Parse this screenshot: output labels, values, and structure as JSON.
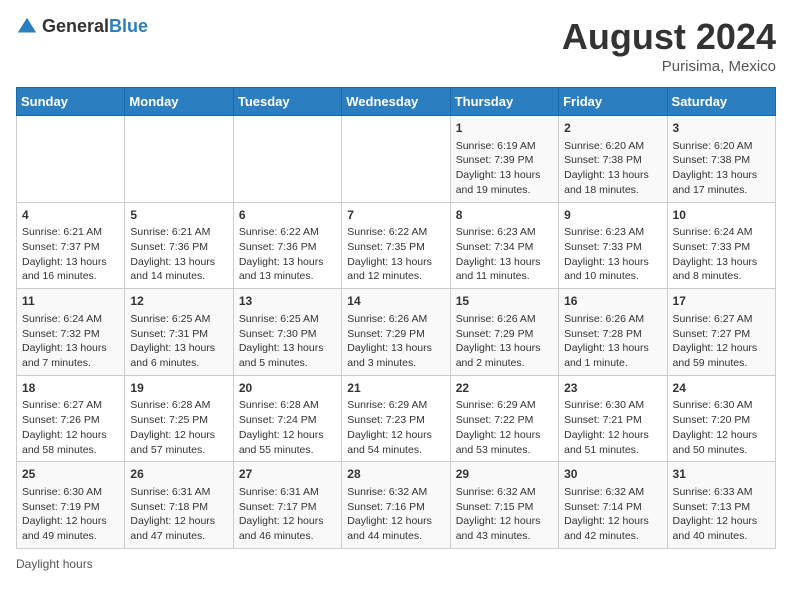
{
  "header": {
    "logo_general": "General",
    "logo_blue": "Blue",
    "title": "August 2024",
    "subtitle": "Purisima, Mexico"
  },
  "days_of_week": [
    "Sunday",
    "Monday",
    "Tuesday",
    "Wednesday",
    "Thursday",
    "Friday",
    "Saturday"
  ],
  "weeks": [
    [
      {
        "day": "",
        "info": ""
      },
      {
        "day": "",
        "info": ""
      },
      {
        "day": "",
        "info": ""
      },
      {
        "day": "",
        "info": ""
      },
      {
        "day": "1",
        "info": "Sunrise: 6:19 AM\nSunset: 7:39 PM\nDaylight: 13 hours and 19 minutes."
      },
      {
        "day": "2",
        "info": "Sunrise: 6:20 AM\nSunset: 7:38 PM\nDaylight: 13 hours and 18 minutes."
      },
      {
        "day": "3",
        "info": "Sunrise: 6:20 AM\nSunset: 7:38 PM\nDaylight: 13 hours and 17 minutes."
      }
    ],
    [
      {
        "day": "4",
        "info": "Sunrise: 6:21 AM\nSunset: 7:37 PM\nDaylight: 13 hours and 16 minutes."
      },
      {
        "day": "5",
        "info": "Sunrise: 6:21 AM\nSunset: 7:36 PM\nDaylight: 13 hours and 14 minutes."
      },
      {
        "day": "6",
        "info": "Sunrise: 6:22 AM\nSunset: 7:36 PM\nDaylight: 13 hours and 13 minutes."
      },
      {
        "day": "7",
        "info": "Sunrise: 6:22 AM\nSunset: 7:35 PM\nDaylight: 13 hours and 12 minutes."
      },
      {
        "day": "8",
        "info": "Sunrise: 6:23 AM\nSunset: 7:34 PM\nDaylight: 13 hours and 11 minutes."
      },
      {
        "day": "9",
        "info": "Sunrise: 6:23 AM\nSunset: 7:33 PM\nDaylight: 13 hours and 10 minutes."
      },
      {
        "day": "10",
        "info": "Sunrise: 6:24 AM\nSunset: 7:33 PM\nDaylight: 13 hours and 8 minutes."
      }
    ],
    [
      {
        "day": "11",
        "info": "Sunrise: 6:24 AM\nSunset: 7:32 PM\nDaylight: 13 hours and 7 minutes."
      },
      {
        "day": "12",
        "info": "Sunrise: 6:25 AM\nSunset: 7:31 PM\nDaylight: 13 hours and 6 minutes."
      },
      {
        "day": "13",
        "info": "Sunrise: 6:25 AM\nSunset: 7:30 PM\nDaylight: 13 hours and 5 minutes."
      },
      {
        "day": "14",
        "info": "Sunrise: 6:26 AM\nSunset: 7:29 PM\nDaylight: 13 hours and 3 minutes."
      },
      {
        "day": "15",
        "info": "Sunrise: 6:26 AM\nSunset: 7:29 PM\nDaylight: 13 hours and 2 minutes."
      },
      {
        "day": "16",
        "info": "Sunrise: 6:26 AM\nSunset: 7:28 PM\nDaylight: 13 hours and 1 minute."
      },
      {
        "day": "17",
        "info": "Sunrise: 6:27 AM\nSunset: 7:27 PM\nDaylight: 12 hours and 59 minutes."
      }
    ],
    [
      {
        "day": "18",
        "info": "Sunrise: 6:27 AM\nSunset: 7:26 PM\nDaylight: 12 hours and 58 minutes."
      },
      {
        "day": "19",
        "info": "Sunrise: 6:28 AM\nSunset: 7:25 PM\nDaylight: 12 hours and 57 minutes."
      },
      {
        "day": "20",
        "info": "Sunrise: 6:28 AM\nSunset: 7:24 PM\nDaylight: 12 hours and 55 minutes."
      },
      {
        "day": "21",
        "info": "Sunrise: 6:29 AM\nSunset: 7:23 PM\nDaylight: 12 hours and 54 minutes."
      },
      {
        "day": "22",
        "info": "Sunrise: 6:29 AM\nSunset: 7:22 PM\nDaylight: 12 hours and 53 minutes."
      },
      {
        "day": "23",
        "info": "Sunrise: 6:30 AM\nSunset: 7:21 PM\nDaylight: 12 hours and 51 minutes."
      },
      {
        "day": "24",
        "info": "Sunrise: 6:30 AM\nSunset: 7:20 PM\nDaylight: 12 hours and 50 minutes."
      }
    ],
    [
      {
        "day": "25",
        "info": "Sunrise: 6:30 AM\nSunset: 7:19 PM\nDaylight: 12 hours and 49 minutes."
      },
      {
        "day": "26",
        "info": "Sunrise: 6:31 AM\nSunset: 7:18 PM\nDaylight: 12 hours and 47 minutes."
      },
      {
        "day": "27",
        "info": "Sunrise: 6:31 AM\nSunset: 7:17 PM\nDaylight: 12 hours and 46 minutes."
      },
      {
        "day": "28",
        "info": "Sunrise: 6:32 AM\nSunset: 7:16 PM\nDaylight: 12 hours and 44 minutes."
      },
      {
        "day": "29",
        "info": "Sunrise: 6:32 AM\nSunset: 7:15 PM\nDaylight: 12 hours and 43 minutes."
      },
      {
        "day": "30",
        "info": "Sunrise: 6:32 AM\nSunset: 7:14 PM\nDaylight: 12 hours and 42 minutes."
      },
      {
        "day": "31",
        "info": "Sunrise: 6:33 AM\nSunset: 7:13 PM\nDaylight: 12 hours and 40 minutes."
      }
    ]
  ],
  "footer": "Daylight hours"
}
